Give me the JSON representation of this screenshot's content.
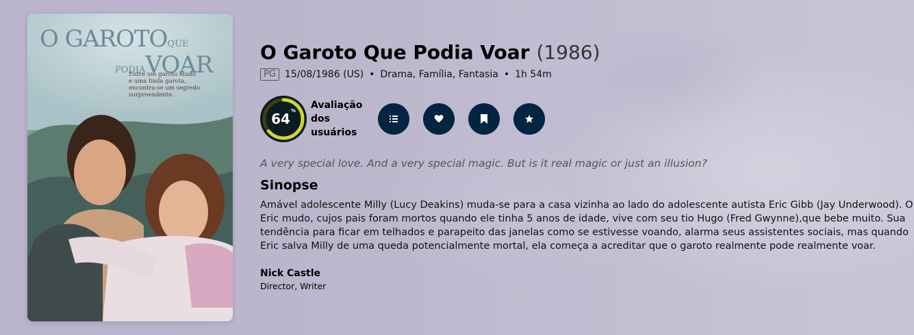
{
  "poster": {
    "title_line1": "O GAROTO",
    "title_que": "QUE",
    "title_podia": "PODIA",
    "title_voar": "VOAR",
    "tagline": [
      "Entre um garoto mudo",
      "e uma linda garota,",
      "encontra-se um segredo surpreendente."
    ]
  },
  "movie": {
    "title": "O Garoto Que Podia Voar",
    "year": "(1986)",
    "certification": "PG",
    "release": "15/08/1986 (US)",
    "genres": "Drama, Família, Fantasia",
    "runtime": "1h 54m",
    "separator": "•"
  },
  "score": {
    "value": "64",
    "percent_sign": "%",
    "fraction": 0.64,
    "ring_color": "#d2d531",
    "track_color": "#423d0f",
    "label_lines": [
      "Avaliação",
      "dos",
      "usuários"
    ]
  },
  "actions": [
    {
      "name": "add-to-list-button",
      "icon": "list-icon"
    },
    {
      "name": "favorite-button",
      "icon": "heart-icon"
    },
    {
      "name": "watchlist-button",
      "icon": "bookmark-icon"
    },
    {
      "name": "rate-button",
      "icon": "star-icon"
    }
  ],
  "tagline": "A very special love. And a very special magic. But is it real magic or just an illusion?",
  "overview": {
    "heading": "Sinopse",
    "text": "Amável adolescente Milly (Lucy Deakins) muda-se para a casa vizinha ao lado do adolescente autista Eric Gibb (Jay Underwood). O Eric mudo, cujos pais foram mortos quando ele tinha 5 anos de idade, vive com seu tio Hugo (Fred Gwynne),que bebe muito. Sua tendência para ficar em telhados e parapeito das janelas como se estivesse voando, alarma seus assistentes sociais, mas quando Eric salva Milly de uma queda potencialmente mortal, ela começa a acreditar que o garoto realmente pode realmente voar."
  },
  "crew": [
    {
      "name": "Nick Castle",
      "role": "Director, Writer"
    }
  ],
  "colors": {
    "accent_dark": "#032541",
    "score_bg": "#081c22"
  }
}
